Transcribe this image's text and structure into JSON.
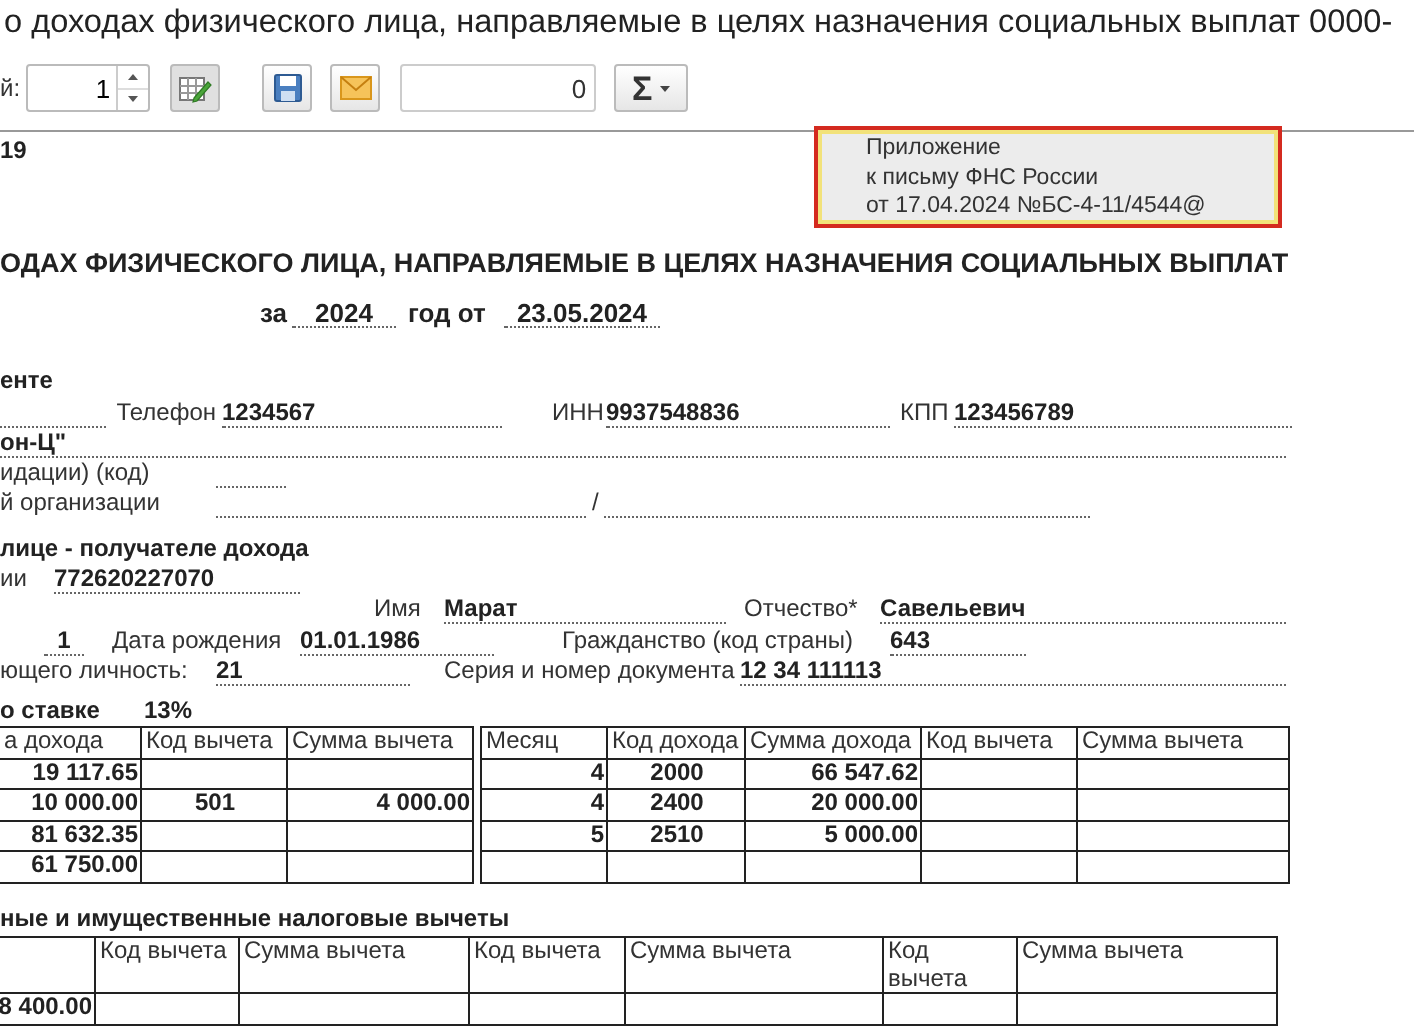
{
  "window": {
    "title": "о доходах физического лица, направляемые в целях назначения социальных выплат 0000-"
  },
  "toolbar": {
    "copies_label": "й:",
    "copies": "1",
    "sum_value": "0",
    "sum_symbol": "Σ"
  },
  "form_number": "19",
  "stamp": {
    "lines": [
      "Приложение",
      "к письму ФНС России",
      "от 17.04.2024 №БС-4-11/4544@"
    ]
  },
  "heading": "ОДАХ ФИЗИЧЕСКОГО ЛИЦА, НАПРАВЛЯЕМЫЕ В ЦЕЛЯХ НАЗНАЧЕНИЯ СОЦИАЛЬНЫХ ВЫПЛАТ",
  "period": {
    "for_label": "за",
    "year": "2024",
    "date_label": "год от",
    "date": "23.05.2024"
  },
  "agent": {
    "section_title": "енте",
    "phone_label": "Телефон",
    "phone": "1234567",
    "inn_label": "ИНН",
    "inn": "9937548836",
    "kpp_label": "КПП",
    "kpp": "123456789",
    "name": "он-Ц\"",
    "liquidation_label": "идации)  (код)",
    "org_label": "й организации",
    "separator": "/"
  },
  "recipient": {
    "section_title": "лице - получателе дохода",
    "inn_label": "ии",
    "inn": "772620227070",
    "first_name_label": "Имя",
    "first_name": "Марат",
    "patronymic_label": "Отчество*",
    "patronymic": "Савельевич",
    "status": "1",
    "birth_label": "Дата рождения",
    "birth_date": "01.01.1986",
    "citizenship_label": "Гражданство (код страны)",
    "citizenship": "643",
    "doc_code_label": "ющего личность:",
    "doc_code": "21",
    "doc_number_label": "Серия и номер документа",
    "doc_number": "12 34 111113"
  },
  "rate": {
    "label": "о ставке",
    "value": "13%"
  },
  "income_left": {
    "columns": [
      "а дохода",
      "Код вычета",
      "Сумма вычета"
    ],
    "rows": [
      [
        "19 117.65",
        "",
        ""
      ],
      [
        "10 000.00",
        "501",
        "4 000.00"
      ],
      [
        "81 632.35",
        "",
        ""
      ],
      [
        "61 750.00",
        "",
        ""
      ]
    ]
  },
  "income_right": {
    "columns": [
      "Месяц",
      "Код дохода",
      "Сумма дохода",
      "Код вычета",
      "Сумма вычета"
    ],
    "rows": [
      [
        "4",
        "2000",
        "66 547.62",
        "",
        ""
      ],
      [
        "4",
        "2400",
        "20 000.00",
        "",
        ""
      ],
      [
        "5",
        "2510",
        "5 000.00",
        "",
        ""
      ],
      [
        "",
        "",
        "",
        "",
        ""
      ]
    ]
  },
  "deductions": {
    "title": "ные и имущественные налоговые вычеты",
    "columns": [
      "",
      "Код вычета",
      "Сумма вычета",
      "Код вычета",
      "Сумма вычета",
      "Код вычета",
      "Сумма вычета"
    ],
    "rows": [
      [
        "8 400.00",
        "",
        "",
        "",
        "",
        "",
        ""
      ]
    ]
  }
}
